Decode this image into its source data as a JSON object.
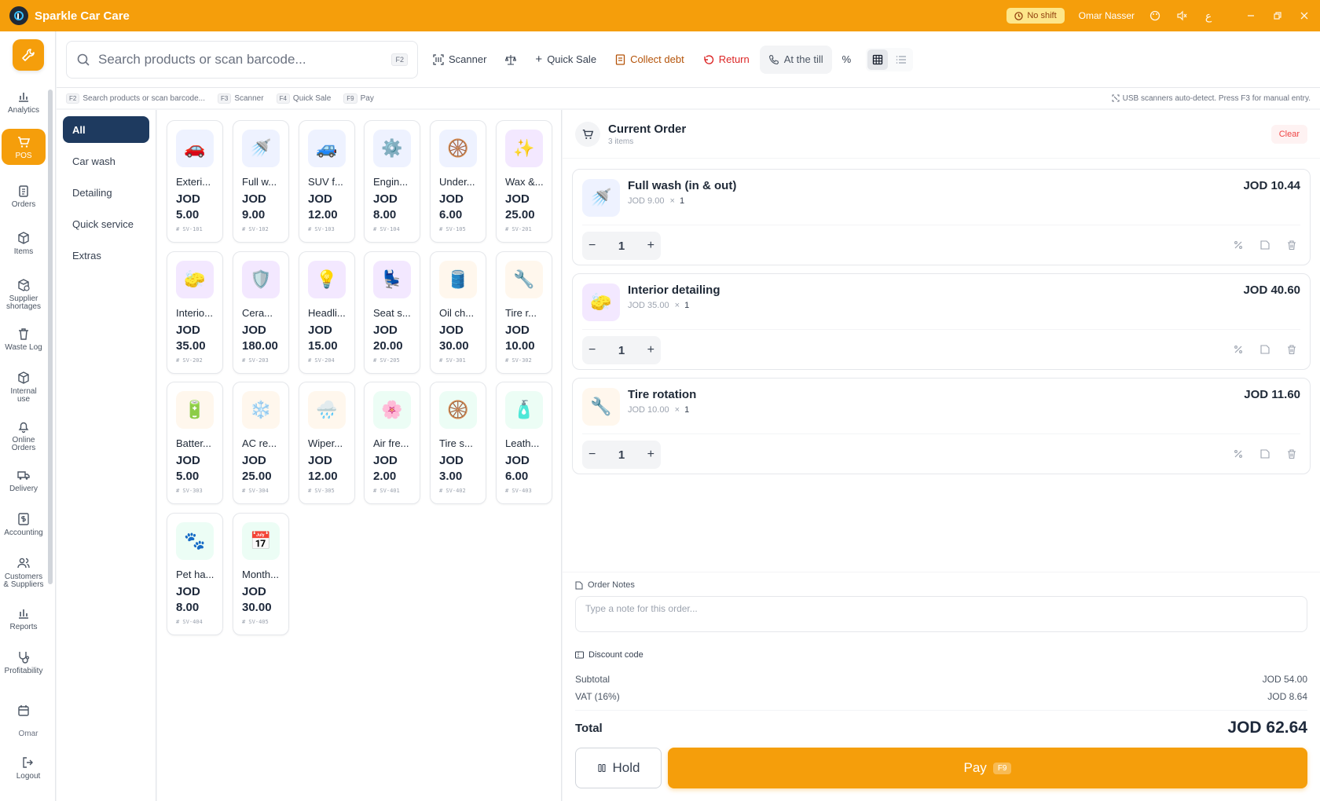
{
  "app": {
    "title": "Sparkle Car Care",
    "shift_badge": "No shift",
    "user_name": "Omar Nasser",
    "lang_toggle": "ع"
  },
  "sidebar": {
    "items": [
      {
        "label": "Analytics"
      },
      {
        "label": "POS"
      },
      {
        "label": "Orders"
      },
      {
        "label": "Items"
      },
      {
        "label": "Supplier shortages"
      },
      {
        "label": "Waste Log"
      },
      {
        "label": "Internal use"
      },
      {
        "label": "Online Orders"
      },
      {
        "label": "Delivery"
      },
      {
        "label": "Accounting"
      },
      {
        "label": "Customers & Suppliers"
      },
      {
        "label": "Reports"
      },
      {
        "label": "Profitability"
      }
    ],
    "user_label": "Omar",
    "logout_label": "Logout"
  },
  "toolbar": {
    "search_placeholder": "Search products or scan barcode...",
    "search_kbd": "F2",
    "scanner": "Scanner",
    "quick_sale": "Quick Sale",
    "collect_debt": "Collect debt",
    "return": "Return",
    "at_till": "At the till",
    "percent": "%"
  },
  "hints": {
    "items": [
      {
        "key": "F2",
        "label": "Search products or scan barcode..."
      },
      {
        "key": "F3",
        "label": "Scanner"
      },
      {
        "key": "F4",
        "label": "Quick Sale"
      },
      {
        "key": "F9",
        "label": "Pay"
      }
    ],
    "right": "USB scanners auto-detect. Press F3 for manual entry."
  },
  "categories": [
    "All",
    "Car wash",
    "Detailing",
    "Quick service",
    "Extras"
  ],
  "products": [
    {
      "name": "Exteri...",
      "price": "JOD",
      "price2": "5.00",
      "sku": "# SV-101",
      "icon": "🚗",
      "bg": "#eef2ff"
    },
    {
      "name": "Full w...",
      "price": "JOD",
      "price2": "9.00",
      "sku": "# SV-102",
      "icon": "🚿",
      "bg": "#eef2ff"
    },
    {
      "name": "SUV f...",
      "price": "JOD",
      "price2": "12.00",
      "sku": "# SV-103",
      "icon": "🚙",
      "bg": "#eef2ff"
    },
    {
      "name": "Engin...",
      "price": "JOD",
      "price2": "8.00",
      "sku": "# SV-104",
      "icon": "⚙️",
      "bg": "#eef2ff"
    },
    {
      "name": "Under...",
      "price": "JOD",
      "price2": "6.00",
      "sku": "# SV-105",
      "icon": "🛞",
      "bg": "#eef2ff"
    },
    {
      "name": "Wax &...",
      "price": "JOD",
      "price2": "25.00",
      "sku": "# SV-201",
      "icon": "✨",
      "bg": "#f3e8ff"
    },
    {
      "name": "Interio...",
      "price": "JOD",
      "price2": "35.00",
      "sku": "# SV-202",
      "icon": "🧽",
      "bg": "#f3e8ff"
    },
    {
      "name": "Cera...",
      "price": "JOD",
      "price2": "180.00",
      "sku": "# SV-203",
      "icon": "🛡️",
      "bg": "#f3e8ff"
    },
    {
      "name": "Headli...",
      "price": "JOD",
      "price2": "15.00",
      "sku": "# SV-204",
      "icon": "💡",
      "bg": "#f3e8ff"
    },
    {
      "name": "Seat s...",
      "price": "JOD",
      "price2": "20.00",
      "sku": "# SV-205",
      "icon": "💺",
      "bg": "#f3e8ff"
    },
    {
      "name": "Oil ch...",
      "price": "JOD",
      "price2": "30.00",
      "sku": "# SV-301",
      "icon": "🛢️",
      "bg": "#fff7ed"
    },
    {
      "name": "Tire r...",
      "price": "JOD",
      "price2": "10.00",
      "sku": "# SV-302",
      "icon": "🔧",
      "bg": "#fff7ed"
    },
    {
      "name": "Batter...",
      "price": "JOD",
      "price2": "5.00",
      "sku": "# SV-303",
      "icon": "🔋",
      "bg": "#fff7ed"
    },
    {
      "name": "AC re...",
      "price": "JOD",
      "price2": "25.00",
      "sku": "# SV-304",
      "icon": "❄️",
      "bg": "#fff7ed"
    },
    {
      "name": "Wiper...",
      "price": "JOD",
      "price2": "12.00",
      "sku": "# SV-305",
      "icon": "🌧️",
      "bg": "#fff7ed"
    },
    {
      "name": "Air fre...",
      "price": "JOD",
      "price2": "2.00",
      "sku": "# SV-401",
      "icon": "🌸",
      "bg": "#ecfdf5"
    },
    {
      "name": "Tire s...",
      "price": "JOD",
      "price2": "3.00",
      "sku": "# SV-402",
      "icon": "🛞",
      "bg": "#ecfdf5"
    },
    {
      "name": "Leath...",
      "price": "JOD",
      "price2": "6.00",
      "sku": "# SV-403",
      "icon": "🧴",
      "bg": "#ecfdf5"
    },
    {
      "name": "Pet ha...",
      "price": "JOD",
      "price2": "8.00",
      "sku": "# SV-404",
      "icon": "🐾",
      "bg": "#ecfdf5"
    },
    {
      "name": "Month...",
      "price": "JOD",
      "price2": "30.00",
      "sku": "# SV-405",
      "icon": "📅",
      "bg": "#ecfdf5"
    }
  ],
  "order": {
    "title": "Current Order",
    "count": "3 items",
    "clear": "Clear",
    "items": [
      {
        "name": "Full wash (in & out)",
        "unit": "JOD 9.00",
        "times": "×",
        "qty_small": "1",
        "total": "JOD 10.44",
        "qty": "1",
        "icon": "🚿",
        "bg": "#eef2ff"
      },
      {
        "name": "Interior detailing",
        "unit": "JOD 35.00",
        "times": "×",
        "qty_small": "1",
        "total": "JOD 40.60",
        "qty": "1",
        "icon": "🧽",
        "bg": "#f3e8ff"
      },
      {
        "name": "Tire rotation",
        "unit": "JOD 10.00",
        "times": "×",
        "qty_small": "1",
        "total": "JOD 11.60",
        "qty": "1",
        "icon": "🔧",
        "bg": "#fff7ed"
      }
    ],
    "notes_label": "Order Notes",
    "notes_placeholder": "Type a note for this order...",
    "discount_label": "Discount code",
    "subtotal_label": "Subtotal",
    "subtotal": "JOD 54.00",
    "vat_label": "VAT (16%)",
    "vat": "JOD 8.64",
    "total_label": "Total",
    "total": "JOD 62.64",
    "hold": "Hold",
    "pay": "Pay",
    "pay_kbd": "F9"
  },
  "colors": {
    "brand": "#f59e0b",
    "active_category": "#1e3a5f",
    "danger": "#ef4444"
  }
}
